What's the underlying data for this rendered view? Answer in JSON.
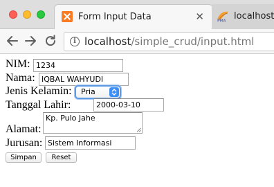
{
  "browser": {
    "tabs": [
      {
        "title": "Form Input Data",
        "icon": "xampp-favicon-icon",
        "active": true
      },
      {
        "title": "localhost /",
        "icon": "phpmyadmin-favicon-icon",
        "active": false
      }
    ],
    "url": {
      "host": "localhost",
      "path": "/simple_crud/input.html"
    }
  },
  "form": {
    "nim": {
      "label": "NIM:",
      "value": "1234"
    },
    "nama": {
      "label": "Nama:",
      "value": "IQBAL WAHYUDI"
    },
    "jenis_kelamin": {
      "label": "Jenis Kelamin:",
      "selected": "Pria"
    },
    "tanggal_lahir": {
      "label": "Tanggal Lahir:",
      "value": "2000-03-10"
    },
    "alamat": {
      "label": "Alamat:",
      "value": "Kp. Pulo Jahe"
    },
    "jurusan": {
      "label": "Jurusan:",
      "value": "Sistem Informasi"
    },
    "submit_label": "Simpan",
    "reset_label": "Reset"
  },
  "colors": {
    "select_focus": "#5d9ae6",
    "select_arrow": "#3d8ef7",
    "xampp_orange": "#fb7a24"
  }
}
